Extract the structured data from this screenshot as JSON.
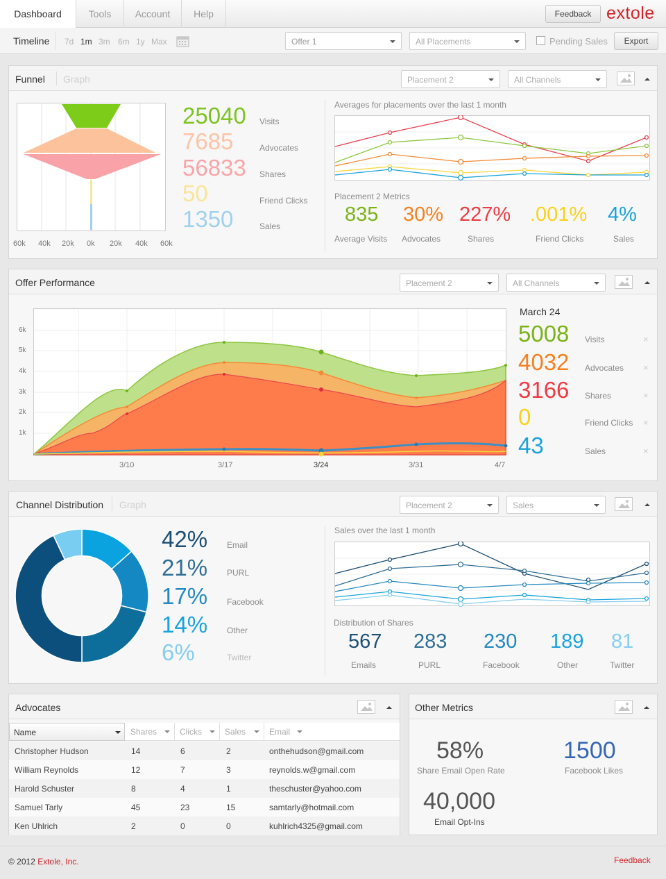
{
  "nav": {
    "tabs": [
      "Dashboard",
      "Tools",
      "Account",
      "Help"
    ],
    "feedback": "Feedback",
    "logo": "extole"
  },
  "timeline": {
    "label": "Timeline",
    "ranges": [
      "7d",
      "1m",
      "3m",
      "6m",
      "1y",
      "Max"
    ],
    "selected": "1m",
    "offer": "Offer 1",
    "placements": "All Placements",
    "pending": "Pending Sales",
    "export": "Export"
  },
  "funnel": {
    "title": "Funnel",
    "tab_graph": "Graph",
    "placement": "Placement 2",
    "channels": "All Channels",
    "axis": [
      "60k",
      "40k",
      "20k",
      "0k",
      "20k",
      "40k",
      "60k"
    ],
    "metrics": [
      {
        "value": "25040",
        "label": "Visits",
        "color": "#7dc321"
      },
      {
        "value": "7685",
        "label": "Advocates",
        "color": "#fbc4a6"
      },
      {
        "value": "56833",
        "label": "Shares",
        "color": "#f8a5a8"
      },
      {
        "value": "50",
        "label": "Friend Clicks",
        "color": "#fbe49a"
      },
      {
        "value": "1350",
        "label": "Sales",
        "color": "#9fd0ee"
      }
    ],
    "avg_title": "Averages for placements over the last 1 month",
    "placement_metrics_title": "Placement 2 Metrics",
    "pm": [
      {
        "value": "835",
        "label": "Average Visits",
        "color": "#7ab317"
      },
      {
        "value": "30%",
        "label": "Advocates",
        "color": "#f48120"
      },
      {
        "value": "227%",
        "label": "Shares",
        "color": "#ee3c44"
      },
      {
        "value": ".001%",
        "label": "Friend Clicks",
        "color": "#f8d21e"
      },
      {
        "value": "4%",
        "label": "Sales",
        "color": "#1aa2d8"
      }
    ]
  },
  "offer": {
    "title": "Offer Performance",
    "placement": "Placement 2",
    "channels": "All Channels",
    "date": "March 24",
    "y_ticks": [
      "6k",
      "5k",
      "4k",
      "3k",
      "2k",
      "1k"
    ],
    "x_ticks": [
      "3/10",
      "3/17",
      "3/24",
      "3/31",
      "4/7"
    ],
    "metrics": [
      {
        "value": "5008",
        "label": "Visits",
        "color": "#7ab317"
      },
      {
        "value": "4032",
        "label": "Advocates",
        "color": "#f48120"
      },
      {
        "value": "3166",
        "label": "Shares",
        "color": "#ee3c44"
      },
      {
        "value": "0",
        "label": "Friend Clicks",
        "color": "#f8d21e"
      },
      {
        "value": "43",
        "label": "Sales",
        "color": "#1aa2d8"
      }
    ],
    "close": "×"
  },
  "channel": {
    "title": "Channel Distribution",
    "tab_graph": "Graph",
    "placement": "Placement 2",
    "metric": "Sales",
    "metrics": [
      {
        "value": "42%",
        "label": "Email",
        "color": "#1d4e75"
      },
      {
        "value": "21%",
        "label": "PURL",
        "color": "#2f6e94"
      },
      {
        "value": "17%",
        "label": "Facebook",
        "color": "#2489bf"
      },
      {
        "value": "14%",
        "label": "Other",
        "color": "#19a2dd"
      },
      {
        "value": "6%",
        "label": "Twitter",
        "color": "#87cdef"
      }
    ],
    "sales_title": "Sales over the last 1 month",
    "dist_title": "Distribution of Shares",
    "dist": [
      {
        "value": "567",
        "label": "Emails",
        "color": "#1d4e75"
      },
      {
        "value": "283",
        "label": "PURL",
        "color": "#2f6e94"
      },
      {
        "value": "230",
        "label": "Facebook",
        "color": "#2489bf"
      },
      {
        "value": "189",
        "label": "Other",
        "color": "#19a2dd"
      },
      {
        "value": "81",
        "label": "Twitter",
        "color": "#87cdef"
      }
    ]
  },
  "advocates": {
    "title": "Advocates",
    "columns": [
      "Name",
      "Shares",
      "Clicks",
      "Sales",
      "Email"
    ],
    "rows": [
      [
        "Christopher Hudson",
        "14",
        "6",
        "2",
        "onthehudson@gmail.com"
      ],
      [
        "William Reynolds",
        "12",
        "7",
        "3",
        "reynolds.w@gmail.com"
      ],
      [
        "Harold Schuster",
        "8",
        "4",
        "1",
        "theschuster@yahoo.com"
      ],
      [
        "Samuel Tarly",
        "45",
        "23",
        "15",
        "samtarly@hotmail.com"
      ],
      [
        "Ken Uhlrich",
        "2",
        "0",
        "0",
        "kuhlrich4325@gmail.com"
      ]
    ]
  },
  "other": {
    "title": "Other Metrics",
    "m1": {
      "value": "58%",
      "label": "Share Email Open Rate"
    },
    "m2": {
      "value": "1500",
      "label": "Facebook Likes"
    },
    "m3": {
      "value": "40,000",
      "label": "Email Opt-Ins"
    }
  },
  "footer": {
    "copyright": "© 2012",
    "company": "Extole, Inc.",
    "feedback": "Feedback"
  }
}
